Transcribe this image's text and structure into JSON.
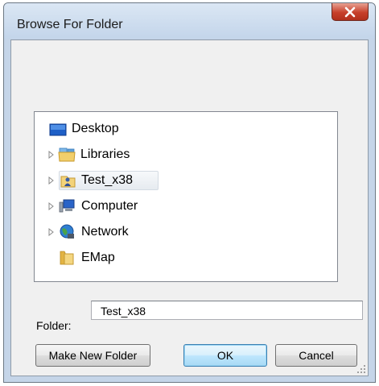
{
  "window": {
    "title": "Browse For Folder",
    "close_symbol": "X"
  },
  "tree": {
    "items": [
      {
        "label": "Desktop",
        "icon": "desktop-icon",
        "has_expander": false,
        "selected": false
      },
      {
        "label": "Libraries",
        "icon": "libraries-icon",
        "has_expander": true,
        "selected": false
      },
      {
        "label": "Test_x38",
        "icon": "user-folder-icon",
        "has_expander": true,
        "selected": true
      },
      {
        "label": "Computer",
        "icon": "computer-icon",
        "has_expander": true,
        "selected": false
      },
      {
        "label": "Network",
        "icon": "network-icon",
        "has_expander": true,
        "selected": false
      },
      {
        "label": "EMap",
        "icon": "folder-icon",
        "has_expander": false,
        "selected": false
      }
    ]
  },
  "folder": {
    "label": "Folder:",
    "value": "Test_x38"
  },
  "buttons": {
    "make_new_folder": "Make New Folder",
    "ok": "OK",
    "cancel": "Cancel"
  },
  "colors": {
    "frame": "#c5d5e8",
    "close_button": "#c7402b",
    "client": "#f0f0f0"
  }
}
